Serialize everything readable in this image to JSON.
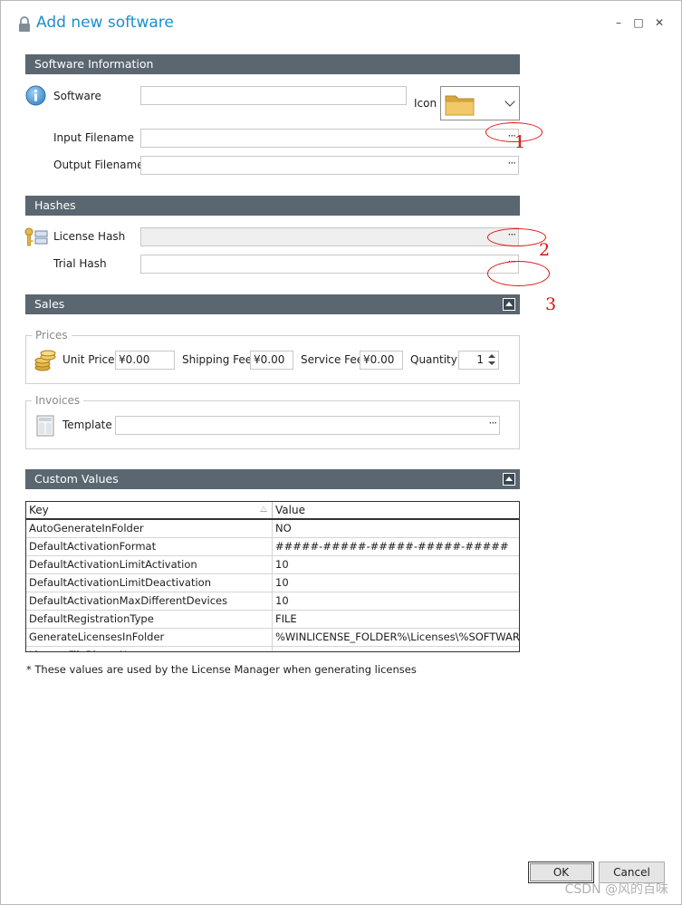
{
  "window": {
    "title": "Add new software",
    "minimize_glyph": "–",
    "maximize_glyph": "□",
    "close_glyph": "✕"
  },
  "software_info": {
    "section_title": "Software Information",
    "software_label": "Software",
    "software_value": "",
    "icon_label": "Icon",
    "input_filename_label": "Input Filename",
    "input_filename_value": "",
    "output_filename_label": "Output Filename",
    "output_filename_value": "",
    "browse_glyph": "···"
  },
  "hashes": {
    "section_title": "Hashes",
    "license_hash_label": "License Hash",
    "license_hash_value": "",
    "trial_hash_label": "Trial Hash",
    "trial_hash_value": ""
  },
  "sales": {
    "section_title": "Sales",
    "prices_group": "Prices",
    "unit_price_label": "Unit Price",
    "unit_price_value": "¥0.00",
    "shipping_fee_label": "Shipping Fee",
    "shipping_fee_value": "¥0.00",
    "service_fee_label": "Service Fee",
    "service_fee_value": "¥0.00",
    "quantity_label": "Quantity",
    "quantity_value": "1",
    "invoices_group": "Invoices",
    "template_label": "Template",
    "template_value": ""
  },
  "custom_values": {
    "section_title": "Custom Values",
    "columns": [
      "Key",
      "Value"
    ],
    "rows": [
      {
        "key": "AutoGenerateInFolder",
        "value": "NO"
      },
      {
        "key": "DefaultActivationFormat",
        "value": "#####-#####-#####-#####-#####"
      },
      {
        "key": "DefaultActivationLimitActivation",
        "value": "10"
      },
      {
        "key": "DefaultActivationLimitDeactivation",
        "value": "10"
      },
      {
        "key": "DefaultActivationMaxDifferentDevices",
        "value": "10"
      },
      {
        "key": "DefaultRegistrationType",
        "value": "FILE"
      },
      {
        "key": "GenerateLicensesInFolder",
        "value": "%WINLICENSE_FOLDER%\\Licenses\\%SOFTWARE_N"
      },
      {
        "key": "LicenseFileBinaryN",
        "value": ""
      }
    ],
    "footnote": "* These values are used by the License Manager when generating licenses"
  },
  "buttons": {
    "ok": "OK",
    "cancel": "Cancel"
  },
  "annotations": [
    "1",
    "2",
    "3"
  ],
  "watermark": "CSDN @风的百味",
  "colors": {
    "title_blue": "#1a8fd0",
    "section_bar": "#5a6670",
    "annotation_red": "#e01010"
  }
}
